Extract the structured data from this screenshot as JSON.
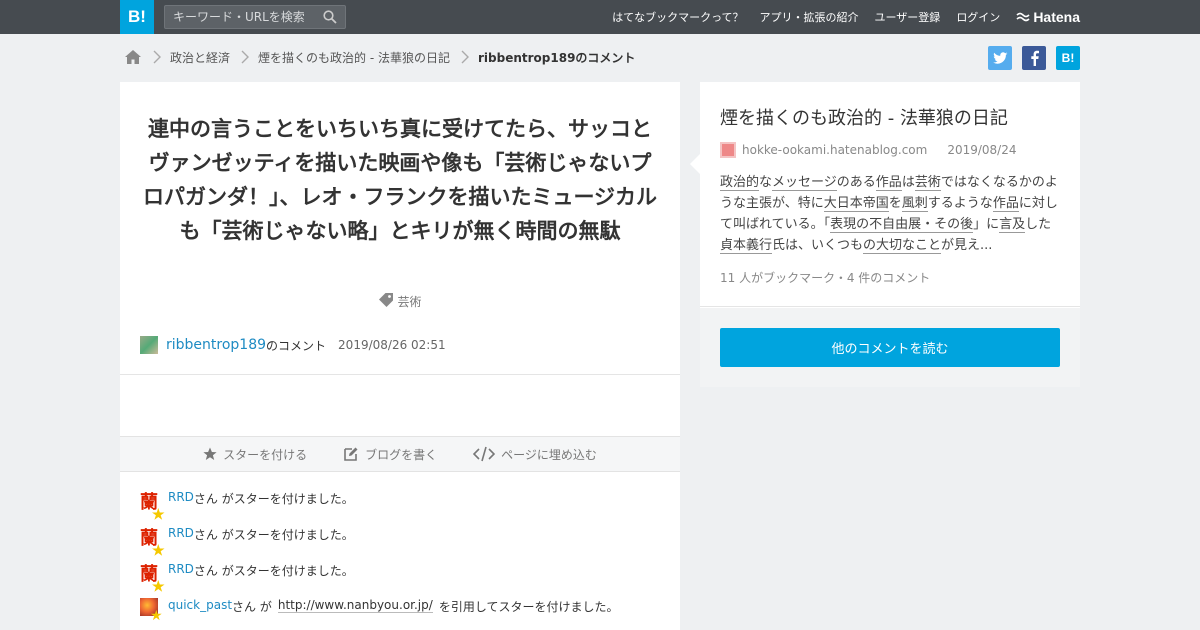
{
  "header": {
    "logo": "B!",
    "search_placeholder": "キーワード・URLを検索",
    "nav": [
      "はてなブックマークって？",
      "アプリ・拡張の紹介",
      "ユーザー登録",
      "ログイン"
    ],
    "brand": "Hatena"
  },
  "breadcrumb": {
    "items": [
      "政治と経済",
      "煙を描くのも政治的 - 法華狼の日記",
      "ribbentrop189のコメント"
    ]
  },
  "share": {
    "twitter": "t",
    "facebook": "f",
    "hatena": "B!"
  },
  "comment": {
    "text": "連中の言うことをいちいち真に受けてたら、サッコとヴァンゼッティを描いた映画や像も「芸術じゃないプロパガンダ！」、レオ・フランクを描いたミュージカルも「芸術じゃない略」とキリが無く時間の無駄",
    "tag": "芸術",
    "user": "ribbentrop189",
    "user_suffix": "のコメント",
    "date": "2019/08/26 02:51"
  },
  "actions": [
    "スターを付ける",
    "ブログを書く",
    "ページに埋め込む"
  ],
  "stars": [
    {
      "icon": "蘭",
      "user": "RRD",
      "text": "さん がスターを付けました。"
    },
    {
      "icon": "蘭",
      "user": "RRD",
      "text": "さん がスターを付けました。"
    },
    {
      "icon": "蘭",
      "user": "RRD",
      "text": "さん がスターを付けました。"
    },
    {
      "user": "quick_past",
      "pre": "さん が",
      "quote": "http://www.nanbyou.or.jp/",
      "post": "を引用してスターを付けました。"
    }
  ],
  "entry": {
    "title": "煙を描くのも政治的 - 法華狼の日記",
    "domain": "hokke-ookami.hatenablog.com",
    "date": "2019/08/24",
    "excerpt": {
      "k1": "政治的",
      "t1": "な",
      "k2": "メッセージ",
      "t2": "のある",
      "k3": "作品",
      "t3": "は",
      "k4": "芸術",
      "t4": "ではなくなるかのような主張が、特に",
      "k5": "大日本帝国",
      "t5": "を",
      "k6": "風刺",
      "t6": "するような",
      "k7": "作品",
      "t7": "に対して叫ばれている。「",
      "k8": "表現の不自由展・その後",
      "t8": "」に",
      "k9": "言及",
      "t9": "した",
      "k10": "貞本義行",
      "t10": "氏は、いくつも",
      "k11": "の大切なこと",
      "t11": "が見え..."
    },
    "counts": "11 人がブックマーク・4 件のコメント",
    "more_button": "他のコメントを読む"
  },
  "colors": {
    "topbar": "#464b50",
    "brand_blue": "#00a4de",
    "link": "#1e8bc3"
  }
}
